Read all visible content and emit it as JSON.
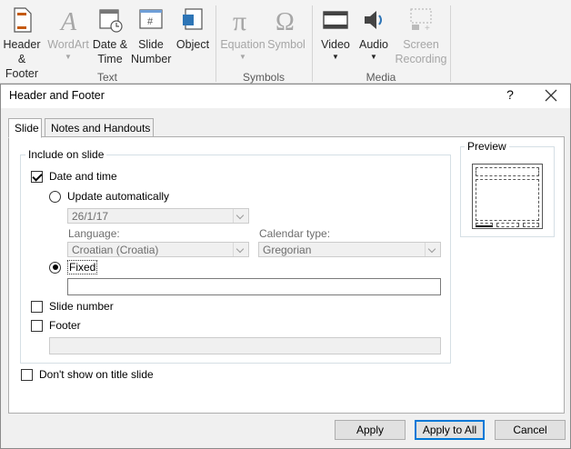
{
  "ribbon": {
    "groups": {
      "text": {
        "label": "Text"
      },
      "symbols": {
        "label": "Symbols"
      },
      "media": {
        "label": "Media"
      }
    },
    "buttons": {
      "header_footer": {
        "label": "Header\n& Footer",
        "icon": "header-footer-icon"
      },
      "wordart": {
        "label": "WordArt",
        "icon": "wordart-icon"
      },
      "date_time": {
        "label": "Date &\nTime",
        "icon": "calendar-icon"
      },
      "slide_number": {
        "label": "Slide\nNumber",
        "icon": "slide-number-icon"
      },
      "object": {
        "label": "Object",
        "icon": "object-icon"
      },
      "equation": {
        "label": "Equation",
        "icon": "pi-icon"
      },
      "symbol": {
        "label": "Symbol",
        "icon": "omega-icon"
      },
      "video": {
        "label": "Video",
        "icon": "film-icon"
      },
      "audio": {
        "label": "Audio",
        "icon": "speaker-icon"
      },
      "screen_recording": {
        "label": "Screen\nRecording",
        "icon": "screen-recording-icon"
      }
    }
  },
  "dialog": {
    "title": "Header and Footer",
    "help": "?",
    "tabs": [
      {
        "label": "Slide",
        "active": true
      },
      {
        "label": "Notes and Handouts",
        "active": false
      }
    ],
    "include_group": {
      "title": "Include on slide"
    },
    "date_time": {
      "label": "Date and time",
      "checked": true
    },
    "update_auto": {
      "label": "Update automatically",
      "selected": false,
      "date_value": "26/1/17"
    },
    "language": {
      "label": "Language:",
      "value": "Croatian (Croatia)"
    },
    "calendar": {
      "label": "Calendar type:",
      "value": "Gregorian"
    },
    "fixed": {
      "label": "Fixed",
      "selected": true,
      "value": ""
    },
    "slide_number": {
      "label": "Slide number",
      "checked": false
    },
    "footer": {
      "label": "Footer",
      "checked": false,
      "value": ""
    },
    "dont_show": {
      "label": "Don't show on title slide",
      "checked": false
    },
    "preview": {
      "title": "Preview"
    },
    "buttons": {
      "apply": "Apply",
      "apply_all": "Apply to All",
      "cancel": "Cancel"
    }
  }
}
